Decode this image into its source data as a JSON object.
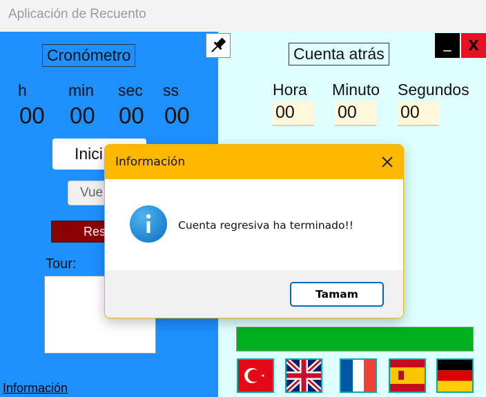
{
  "window": {
    "title": "Aplicación de Recuento"
  },
  "stopwatch": {
    "label": "Cronómetro",
    "units": [
      "h",
      "min",
      "sec",
      "ss"
    ],
    "values": [
      "00",
      "00",
      "00",
      "00"
    ],
    "start_label": "Inici",
    "lap_label": "Vue",
    "reset_label": "Res",
    "tour_label": "Tour:",
    "info_link": "Información"
  },
  "countdown": {
    "label": "Cuenta atrás",
    "hour_label": "Hora",
    "minute_label": "Minuto",
    "second_label": "Segundos",
    "hour_value": "00",
    "minute_value": "00",
    "second_value": "00",
    "progress_color": "#00b020"
  },
  "window_controls": {
    "minimize": "_",
    "close": "X"
  },
  "dialog": {
    "title": "Información",
    "message": "Cuenta regresiva ha terminado!!",
    "ok_label": "Tamam"
  },
  "flags": [
    "turkey-flag-icon",
    "uk-flag-icon",
    "france-flag-icon",
    "spain-flag-icon",
    "germany-flag-icon"
  ]
}
